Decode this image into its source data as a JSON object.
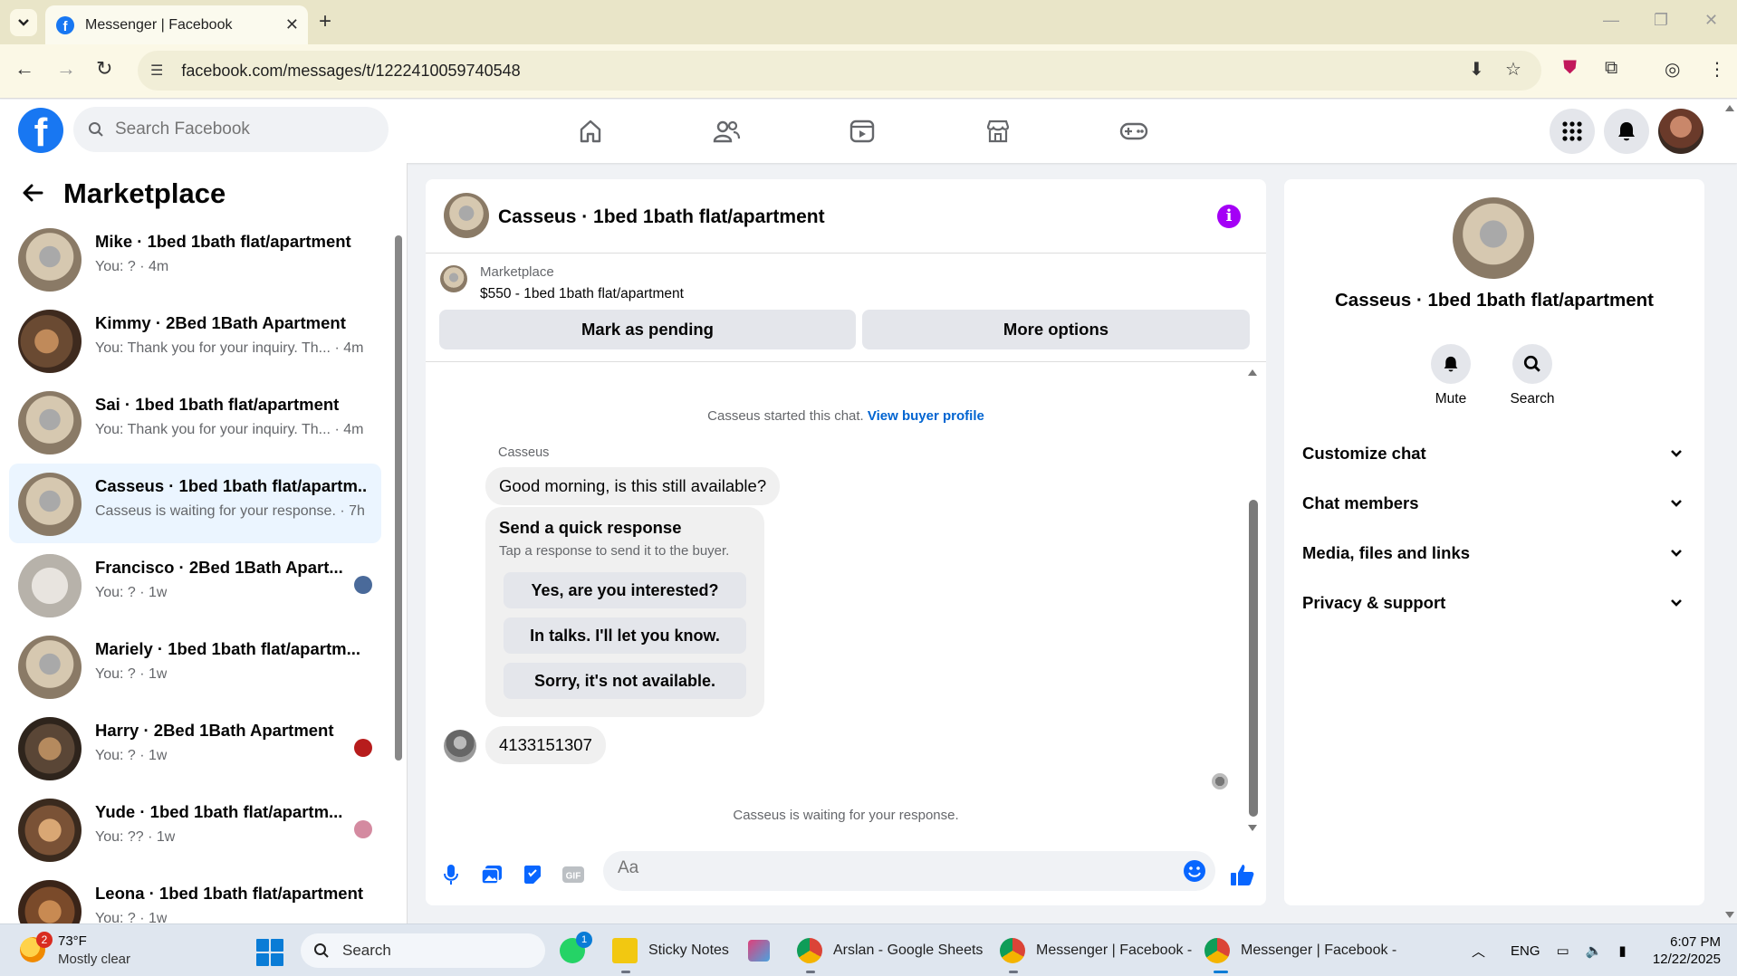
{
  "browser": {
    "tab_title": "Messenger | Facebook",
    "url": "facebook.com/messages/t/1222410059740548"
  },
  "fb_header": {
    "search_placeholder": "Search Facebook",
    "nav_icons": [
      "home-icon",
      "friends-icon",
      "video-icon",
      "marketplace-icon",
      "gaming-icon"
    ]
  },
  "left_panel": {
    "title": "Marketplace",
    "conversations": [
      {
        "name": "Mike · 1bed 1bath flat/apartment",
        "sub": "You: ? · 4m"
      },
      {
        "name": "Kimmy · 2Bed 1Bath Apartment",
        "sub": "You: Thank you for your inquiry. Th... · 4m"
      },
      {
        "name": "Sai · 1bed 1bath flat/apartment",
        "sub": "You: Thank you for your inquiry. Th... · 4m"
      },
      {
        "name": "Casseus · 1bed 1bath flat/apartm...",
        "sub": "Casseus is waiting for your response. · 7h"
      },
      {
        "name": "Francisco · 2Bed 1Bath Apart...",
        "sub": "You: ? · 1w"
      },
      {
        "name": "Mariely · 1bed 1bath flat/apartm...",
        "sub": "You: ? · 1w"
      },
      {
        "name": "Harry · 2Bed 1Bath Apartment",
        "sub": "You: ? · 1w"
      },
      {
        "name": "Yude · 1bed 1bath flat/apartm...",
        "sub": "You: ?? · 1w"
      },
      {
        "name": "Leona · 1bed 1bath flat/apartment",
        "sub": "You: ? · 1w"
      }
    ]
  },
  "chat": {
    "title": "Casseus · 1bed 1bath flat/apartment",
    "listing_source": "Marketplace",
    "listing_title": "$550 - 1bed 1bath flat/apartment",
    "mark_pending": "Mark as pending",
    "more_options": "More options",
    "started_text": "Casseus started this chat.",
    "view_profile": "View buyer profile",
    "sender": "Casseus",
    "message1": "Good morning, is this still available?",
    "quick_title": "Send a quick response",
    "quick_sub": "Tap a response to send it to the buyer.",
    "quick_options": [
      "Yes, are you interested?",
      "In talks. I'll let you know.",
      "Sorry, it's not available."
    ],
    "message2": "4133151307",
    "waiting": "Casseus is waiting for your response.",
    "input_placeholder": "Aa"
  },
  "right_panel": {
    "name": "Casseus · 1bed 1bath flat/apartment",
    "mute": "Mute",
    "search": "Search",
    "sections": [
      "Customize chat",
      "Chat members",
      "Media, files and links",
      "Privacy & support"
    ]
  },
  "taskbar": {
    "weather_badge": "2",
    "temp": "73°F",
    "condition": "Mostly clear",
    "search": "Search",
    "whatsapp_badge": "1",
    "apps": [
      "Sticky Notes",
      "Arslan - Google Sheets",
      "Messenger | Facebook -",
      "Messenger | Facebook -"
    ],
    "lang": "ENG",
    "time": "6:07 PM",
    "date": "12/22/2025"
  },
  "colors": {
    "fb_blue": "#1877f2",
    "info_purple": "#a400f6",
    "selected_bg": "#ebf5ff"
  }
}
